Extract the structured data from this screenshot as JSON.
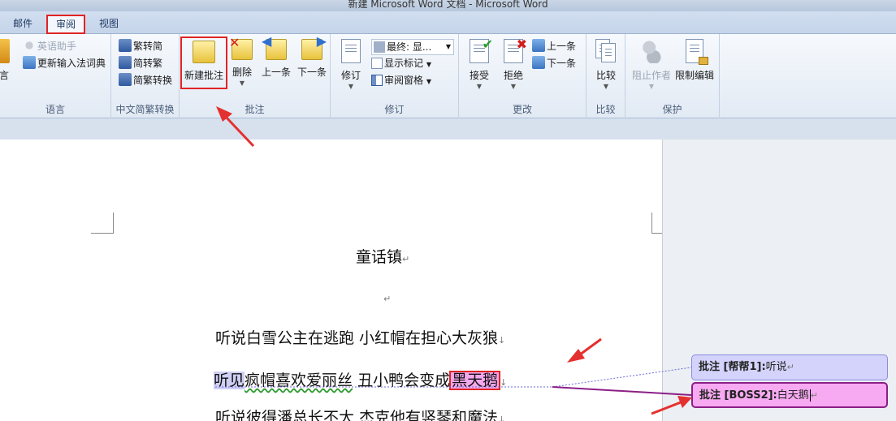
{
  "window": {
    "title": "新建 Microsoft Word 文档 - Microsoft Word"
  },
  "tabs": [
    {
      "label": "邮件",
      "active": false
    },
    {
      "label": "审阅",
      "active": true
    },
    {
      "label": "视图",
      "active": false
    }
  ],
  "ribbon": {
    "language": {
      "label": "语言",
      "partial_button": "言",
      "english_assistant": "英语助手",
      "update_ime_dict": "更新输入法词典"
    },
    "chinese_conversion": {
      "label": "中文简繁转换",
      "to_traditional": "繁转简",
      "to_simplified": "简转繁",
      "convert": "简繁转换"
    },
    "comments": {
      "label": "批注",
      "new_comment": "新建批注",
      "delete": "删除",
      "previous": "上一条",
      "next": "下一条"
    },
    "tracking": {
      "label": "修订",
      "track_changes": "修订",
      "display_select": "最终: 显...",
      "show_markup": "显示标记",
      "reviewing_pane": "审阅窗格"
    },
    "changes": {
      "label": "更改",
      "accept": "接受",
      "reject": "拒绝",
      "previous": "上一条",
      "next": "下一条"
    },
    "compare": {
      "label": "比较",
      "compare": "比较"
    },
    "protect": {
      "label": "保护",
      "block_authors": "阻止作者",
      "restrict_editing": "限制编辑"
    }
  },
  "document": {
    "title": "童话镇",
    "lines": {
      "l1": "听说白雪公主在逃跑  小红帽在担心大灰狼",
      "l2_a": "听见",
      "l2_b": "疯帽喜欢爱丽丝",
      "l2_c": "  丑小鸭会变成",
      "l2_d": "黑天鹅",
      "l3": "听说彼得潘总长不大  杰克他有竖琴和魔法"
    }
  },
  "comments": [
    {
      "tag": "批注 [帮帮1]:",
      "text": "听说"
    },
    {
      "tag": "批注 [BOSS2]:",
      "text": "白天鹅"
    }
  ],
  "colors": {
    "highlight_red": "#e02424",
    "comment1": "#d3d3fb",
    "comment2": "#f7a9f1"
  }
}
